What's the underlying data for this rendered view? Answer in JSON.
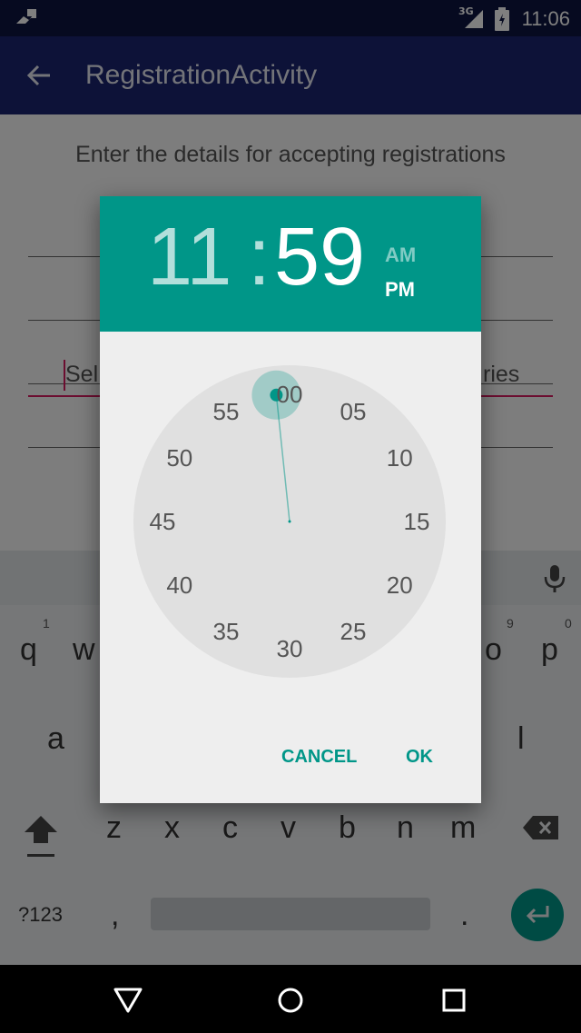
{
  "status_bar": {
    "time": "11:06",
    "network": "3G"
  },
  "app_bar": {
    "title": "RegistrationActivity"
  },
  "content": {
    "heading": "Enter the details for accepting registrations",
    "select_left_fragment": "Sel",
    "select_right_fragment": "ries"
  },
  "keyboard": {
    "row1_visible": [
      "q",
      "w",
      "o",
      "p"
    ],
    "row1_hints": [
      "1",
      "9",
      "0"
    ],
    "row2_visible": [
      "a",
      "l"
    ],
    "row3": [
      "z",
      "x",
      "c",
      "v",
      "b",
      "n",
      "m"
    ],
    "symbols_key": "?123",
    "comma_key": ",",
    "period_key": "."
  },
  "time_picker": {
    "hour": "11",
    "separator": ":",
    "minute": "59",
    "am_label": "AM",
    "pm_label": "PM",
    "selected_period": "PM",
    "dial_labels": [
      "00",
      "05",
      "10",
      "15",
      "20",
      "25",
      "30",
      "35",
      "40",
      "45",
      "50",
      "55"
    ],
    "selected_minute": 59,
    "cancel_label": "CANCEL",
    "ok_label": "OK"
  },
  "colors": {
    "accent": "#009688",
    "app_bar": "#1a2570",
    "status_bar": "#0c1540",
    "cursor": "#d81b60"
  },
  "icons": {
    "back": "arrow-left-icon",
    "mic": "microphone-icon",
    "shift": "shift-arrow-icon",
    "backspace": "backspace-icon",
    "enter": "enter-icon",
    "nav_back": "triangle-back-icon",
    "nav_home": "circle-home-icon",
    "nav_recents": "square-recents-icon"
  }
}
